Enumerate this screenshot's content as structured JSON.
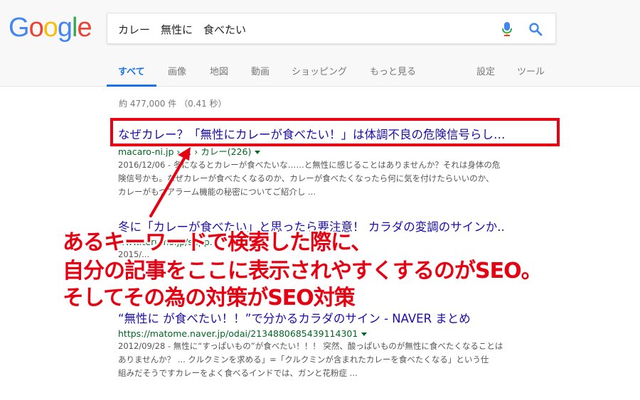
{
  "search": {
    "query": "カレー　無性に　食べたい"
  },
  "logo": {
    "letters": [
      {
        "char": "G",
        "color": "#4285f4"
      },
      {
        "char": "o",
        "color": "#ea4335"
      },
      {
        "char": "o",
        "color": "#fbbc05"
      },
      {
        "char": "g",
        "color": "#4285f4"
      },
      {
        "char": "l",
        "color": "#34a853"
      },
      {
        "char": "e",
        "color": "#ea4335"
      }
    ]
  },
  "tabs": [
    {
      "label": "すべて"
    },
    {
      "label": "画像"
    },
    {
      "label": "地図"
    },
    {
      "label": "動画"
    },
    {
      "label": "ショッピング"
    },
    {
      "label": "もっと見る"
    },
    {
      "label": "設定"
    },
    {
      "label": "ツール"
    }
  ],
  "stats": "約 477,000 件 （0.41 秒）",
  "results": [
    {
      "title": "なぜカレー？「無性にカレーが食べたい！」は体調不良の危険信号らし…",
      "url": "macaro-ni.jp › ... › カレー(226)",
      "snippet_lines": [
        "2016/12/06 - 冬になるとカレーが食べたいな……と無性に感じることはありませんか？それは身体の危",
        "険信号かも。なぜカレーが食べたくなるのか、カレーが食べたくなったら何に気を付けたらいいのか、",
        "カレーがもつアラーム機能の秘密についてご紹介し ..."
      ]
    },
    {
      "title": "冬に「カレーが食べたい」と思ったら要注意！ カラダの変調のサインか..",
      "url": "www.terumo.jp/supp...",
      "snippet_lines": [
        "2015/...",
        "",
        ""
      ]
    },
    {
      "title": "“無性に が食べたい！！”で分かるカラダのサイン - NAVER まとめ",
      "url": "https://matome.naver.jp/odai/2134880685439114301",
      "snippet_lines": [
        "2012/09/28 - 無性に“すっぱいもの”が食べたい！！！ 突然、酸っぱいものが無性に食べたくなることは",
        "ありませんか？ ... クルクミンを求める」=「クルクミンが含まれたカレーを食べたくなる」という仕",
        "組みだそうですカレーをよく食べるインドでは、ガンと花粉症 ..."
      ]
    }
  ],
  "annotation": {
    "lines": [
      "あるキーワードで検索した際に、",
      "自分の記事をここに表示されやすくするのがSEO。",
      "そしてその為の対策がSEO対策"
    ],
    "color": "#e60012"
  },
  "colors": {
    "link": "#1a0dab",
    "url": "#006621",
    "accent": "#1a73e8"
  }
}
